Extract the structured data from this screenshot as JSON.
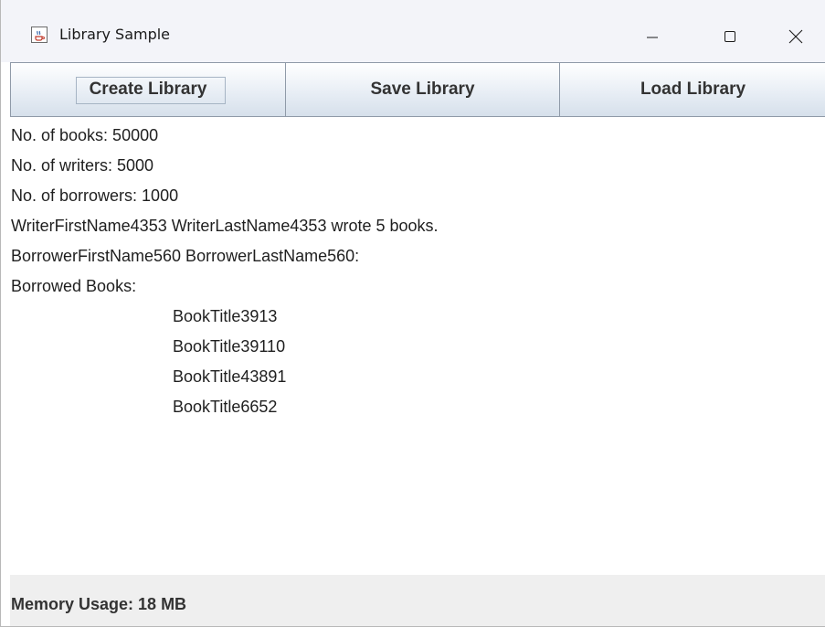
{
  "window": {
    "title": "Library Sample",
    "app_icon": "java-cup-icon",
    "controls": {
      "minimize_icon": "minimize-icon",
      "maximize_icon": "maximize-icon",
      "close_icon": "close-icon"
    }
  },
  "toolbar": {
    "create_label": "Create Library",
    "save_label": "Save Library",
    "load_label": "Load Library"
  },
  "output": {
    "lines": [
      "No. of books: 50000",
      "No. of writers: 5000",
      "No. of borrowers: 1000",
      "WriterFirstName4353 WriterLastName4353 wrote 5 books.",
      "BorrowerFirstName560 BorrowerLastName560:",
      "Borrowed Books:"
    ],
    "borrowed_books": [
      "BookTitle3913",
      "BookTitle39110",
      "BookTitle43891",
      "BookTitle6652"
    ]
  },
  "status": {
    "memory": "Memory Usage: 18 MB"
  },
  "colors": {
    "titlebar": "#f3f4f9",
    "button_border": "#8f9aa8",
    "statusbar": "#efefef"
  }
}
